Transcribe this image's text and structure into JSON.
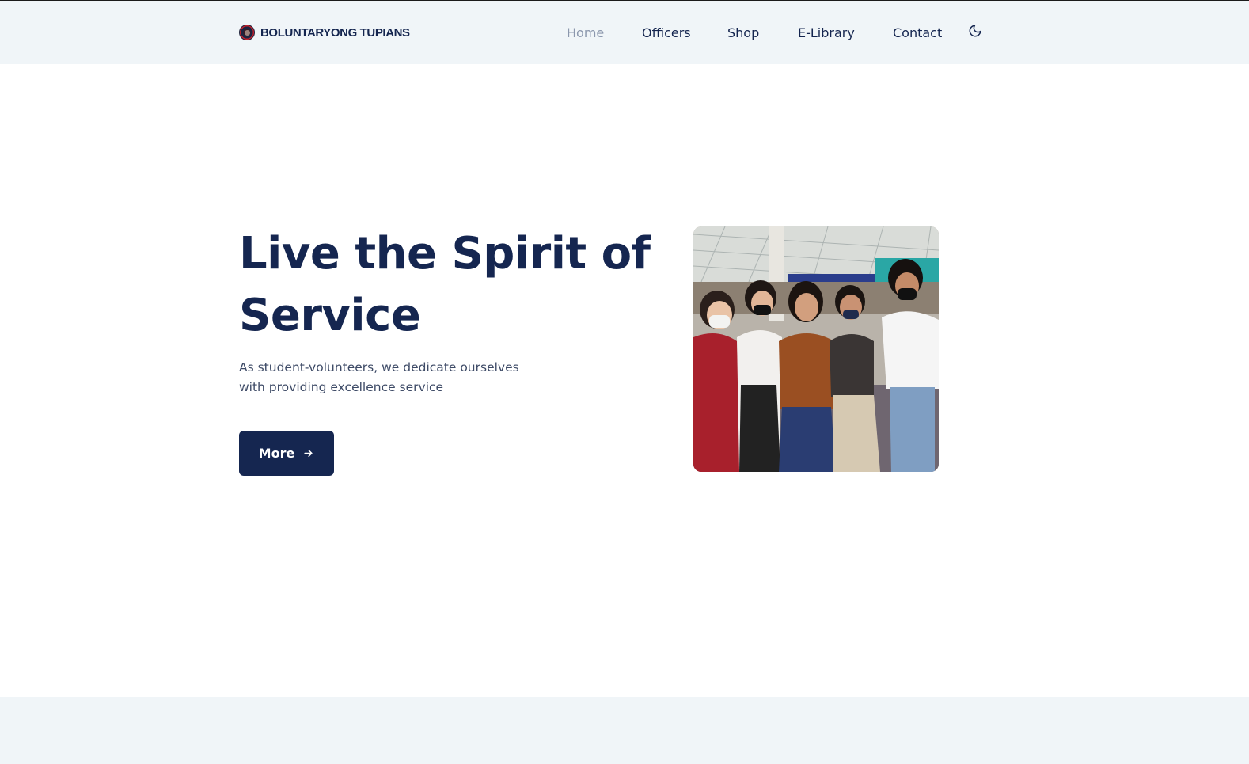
{
  "brand": {
    "name": "BOLUNTARYONG TUPIANS",
    "logo_icon": "org-seal-logo"
  },
  "nav": {
    "items": [
      {
        "label": "Home",
        "active": true
      },
      {
        "label": "Officers",
        "active": false
      },
      {
        "label": "Shop",
        "active": false
      },
      {
        "label": "E-Library",
        "active": false
      },
      {
        "label": "Contact",
        "active": false
      }
    ],
    "theme_toggle_icon": "moon-icon"
  },
  "hero": {
    "title_line1": "Live the Spirit of",
    "title_line2": "Service",
    "subtitle_line1": "As student-volunteers, we dedicate ourselves",
    "subtitle_line2": "with providing excellence service",
    "button_label": "More",
    "button_icon": "arrow-right-icon",
    "image_icon": "group-photo-volunteers"
  },
  "colors": {
    "primary": "#152650",
    "nav_active": "#8b97ad",
    "header_bg": "#f0f5f8",
    "body_text": "#3d4a66"
  }
}
